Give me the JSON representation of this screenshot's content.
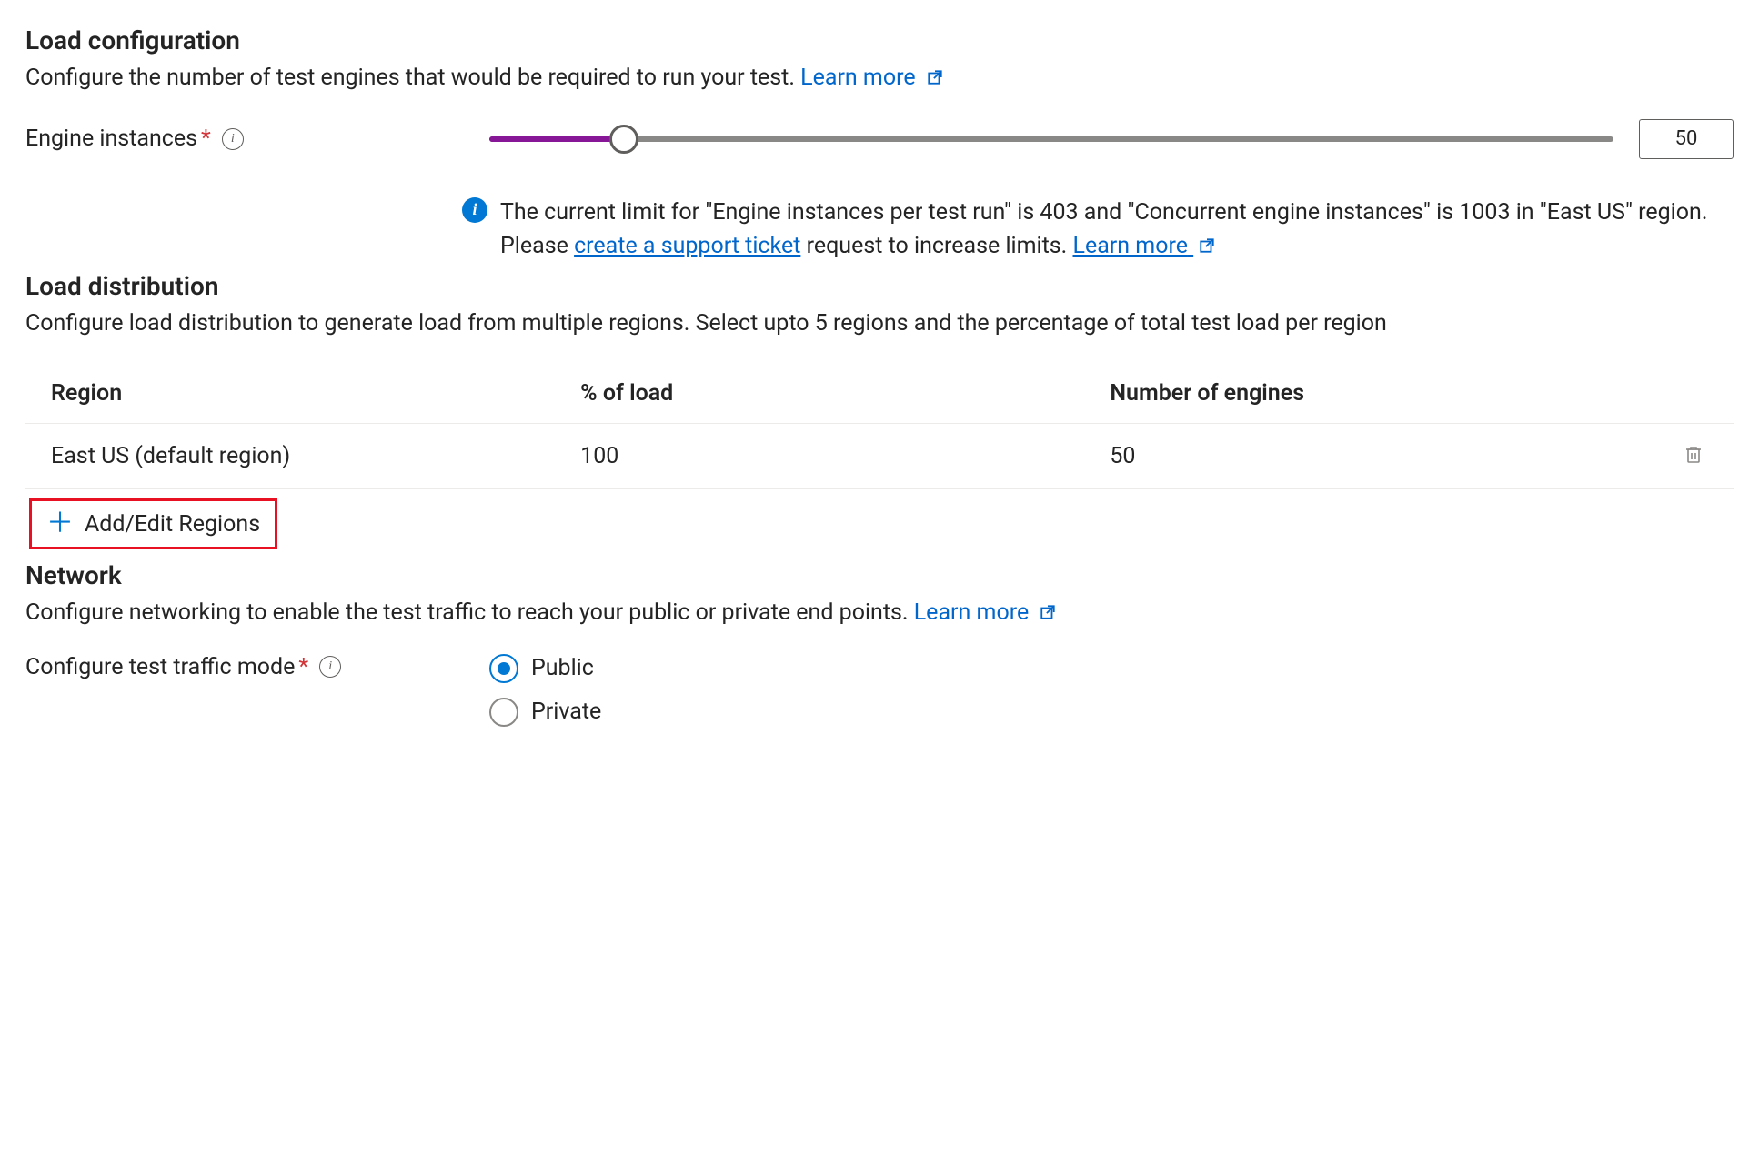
{
  "loadConfig": {
    "title": "Load configuration",
    "desc": "Configure the number of test engines that would be required to run your test. ",
    "learnMore": "Learn more",
    "engineInstancesLabel": "Engine instances",
    "engineInstancesValue": "50",
    "sliderPercent": 12
  },
  "infoBar": {
    "pre": "The current limit for \"Engine instances per test run\" is 403 and \"Concurrent engine instances\" is 1003 in \"East US\" region. Please ",
    "ticketLink": "create a support ticket",
    "mid": " request to increase limits. ",
    "learnMore": "Learn more"
  },
  "loadDist": {
    "title": "Load distribution",
    "desc": "Configure load distribution to generate load from multiple regions. Select upto 5 regions and the percentage of total test load per region",
    "headers": {
      "region": "Region",
      "load": "% of load",
      "engines": "Number of engines"
    },
    "rows": [
      {
        "region": "East US (default region)",
        "load": "100",
        "engines": "50"
      }
    ],
    "addEdit": "Add/Edit Regions"
  },
  "network": {
    "title": "Network",
    "desc": "Configure networking to enable the test traffic to reach your public or private end points. ",
    "learnMore": "Learn more",
    "modeLabel": "Configure test traffic mode",
    "options": {
      "public": "Public",
      "private": "Private"
    },
    "selected": "public"
  }
}
